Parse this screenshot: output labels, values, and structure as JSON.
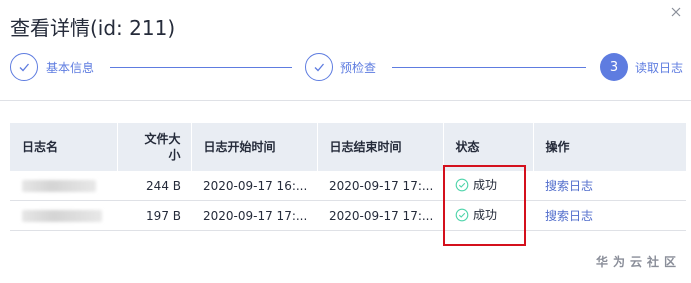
{
  "dialog": {
    "title": "查看详情(id: 211)"
  },
  "steps": [
    {
      "label": "基本信息",
      "state": "done"
    },
    {
      "label": "预检查",
      "state": "done"
    },
    {
      "label": "读取日志",
      "state": "active",
      "number": "3"
    }
  ],
  "table": {
    "headers": {
      "name": "日志名",
      "size_line1": "文件大",
      "size_line2": "小",
      "start": "日志开始时间",
      "end": "日志结束时间",
      "status": "状态",
      "action": "操作"
    },
    "rows": [
      {
        "size": "244 B",
        "start": "2020-09-17 16:...",
        "end": "2020-09-17 17:...",
        "status": "成功",
        "action": "搜索日志"
      },
      {
        "size": "197 B",
        "start": "2020-09-17 17:...",
        "end": "2020-09-17 17:...",
        "status": "成功",
        "action": "搜索日志"
      }
    ]
  },
  "watermark": "华为云社区",
  "colors": {
    "accent": "#5e7ce0",
    "link": "#526ecc",
    "success": "#50d4ab",
    "highlight": "#d4101c"
  },
  "icons": {
    "close": "close-icon",
    "check": "check-icon",
    "success": "success-circle-icon"
  }
}
